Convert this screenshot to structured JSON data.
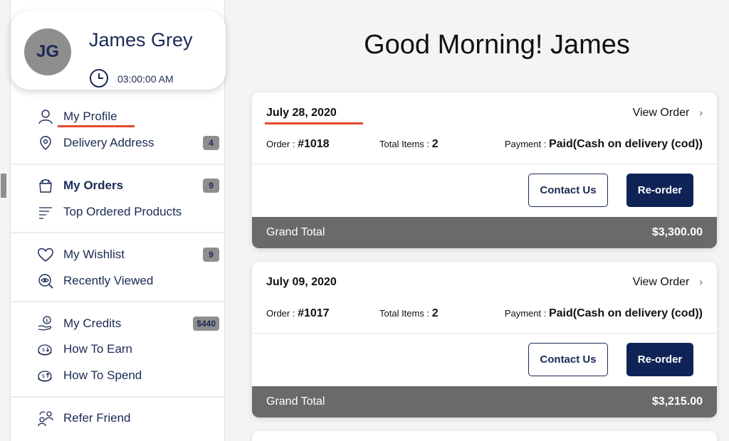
{
  "user": {
    "initials": "JG",
    "name": "James Grey",
    "time": "03:00:00 AM"
  },
  "greeting": "Good Morning! James",
  "sidebar": {
    "groups": [
      {
        "items": [
          {
            "label": "My Profile",
            "icon": "user-icon"
          },
          {
            "label": "Delivery Address",
            "icon": "location-pin-icon",
            "badge": "4"
          }
        ]
      },
      {
        "items": [
          {
            "label": "My Orders",
            "icon": "shopping-bag-icon",
            "badge": "9",
            "active": true
          },
          {
            "label": "Top Ordered Products",
            "icon": "list-lines-icon"
          }
        ]
      },
      {
        "items": [
          {
            "label": "My Wishlist",
            "icon": "heart-icon",
            "badge": "9"
          },
          {
            "label": "Recently Viewed",
            "icon": "eye-search-icon"
          }
        ]
      },
      {
        "items": [
          {
            "label": "My Credits",
            "icon": "dollar-hand-icon",
            "badge": "$440"
          },
          {
            "label": "How To Earn",
            "icon": "coins-earn-icon"
          },
          {
            "label": "How To Spend",
            "icon": "coins-spend-icon"
          }
        ]
      },
      {
        "items": [
          {
            "label": "Refer Friend",
            "icon": "refer-friend-icon"
          }
        ]
      }
    ]
  },
  "orders": [
    {
      "date": "July 28, 2020",
      "view_label": "View Order",
      "order_label": "Order : ",
      "order_no": "#1018",
      "items_label": "Total Items : ",
      "items": "2",
      "payment_label": "Payment : ",
      "payment": "Paid(Cash on delivery (cod))",
      "contact_label": "Contact Us",
      "reorder_label": "Re-order",
      "grand_label": "Grand Total",
      "grand_total": "$3,300.00"
    },
    {
      "date": "July 09, 2020",
      "view_label": "View Order",
      "order_label": "Order : ",
      "order_no": "#1017",
      "items_label": "Total Items : ",
      "items": "2",
      "payment_label": "Payment : ",
      "payment": "Paid(Cash on delivery (cod))",
      "contact_label": "Contact Us",
      "reorder_label": "Re-order",
      "grand_label": "Grand Total",
      "grand_total": "$3,215.00"
    }
  ],
  "colors": {
    "navy": "#1b2a55",
    "button_navy": "#0f2356",
    "accent_red": "#e24a2b",
    "badge_gray": "#8e8e8e",
    "grand_bar": "#6a6a6a"
  }
}
